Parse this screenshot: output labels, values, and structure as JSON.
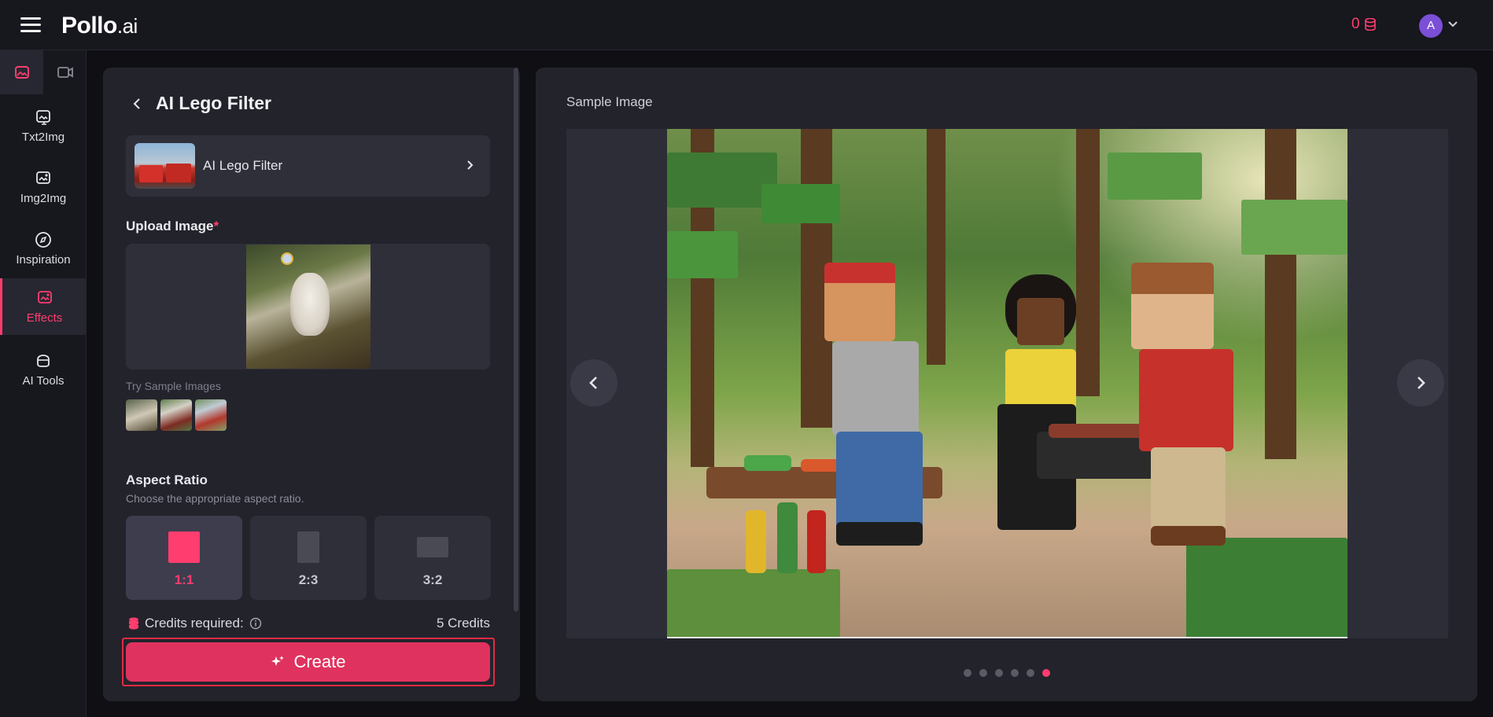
{
  "app": {
    "logo_main": "Pollo",
    "logo_suffix": ".ai"
  },
  "header": {
    "credits": "0",
    "avatar_initial": "A"
  },
  "sidebar": {
    "items": [
      {
        "label": "Txt2Img",
        "icon": "text-to-image-icon"
      },
      {
        "label": "Img2Img",
        "icon": "image-to-image-icon"
      },
      {
        "label": "Inspiration",
        "icon": "compass-icon"
      },
      {
        "label": "Effects",
        "icon": "effects-icon",
        "active": true
      },
      {
        "label": "AI Tools",
        "icon": "ai-tools-icon"
      }
    ]
  },
  "panel": {
    "title": "AI Lego Filter",
    "effect_name": "AI Lego Filter",
    "upload_label": "Upload Image",
    "required_mark": "*",
    "try_samples": "Try Sample Images",
    "aspect_title": "Aspect Ratio",
    "aspect_hint": "Choose the appropriate aspect ratio.",
    "ratios": [
      {
        "label": "1:1",
        "active": true
      },
      {
        "label": "2:3",
        "active": false
      },
      {
        "label": "3:2",
        "active": false
      }
    ],
    "credits_label": "Credits required:",
    "credits_value": "5 Credits",
    "create_label": "Create"
  },
  "viewer": {
    "title": "Sample Image",
    "dot_count": 6,
    "active_dot": 6
  },
  "colors": {
    "accent": "#ff3d6e",
    "button": "#e0325e",
    "panel": "#23232c",
    "bg": "#0f0f14"
  }
}
